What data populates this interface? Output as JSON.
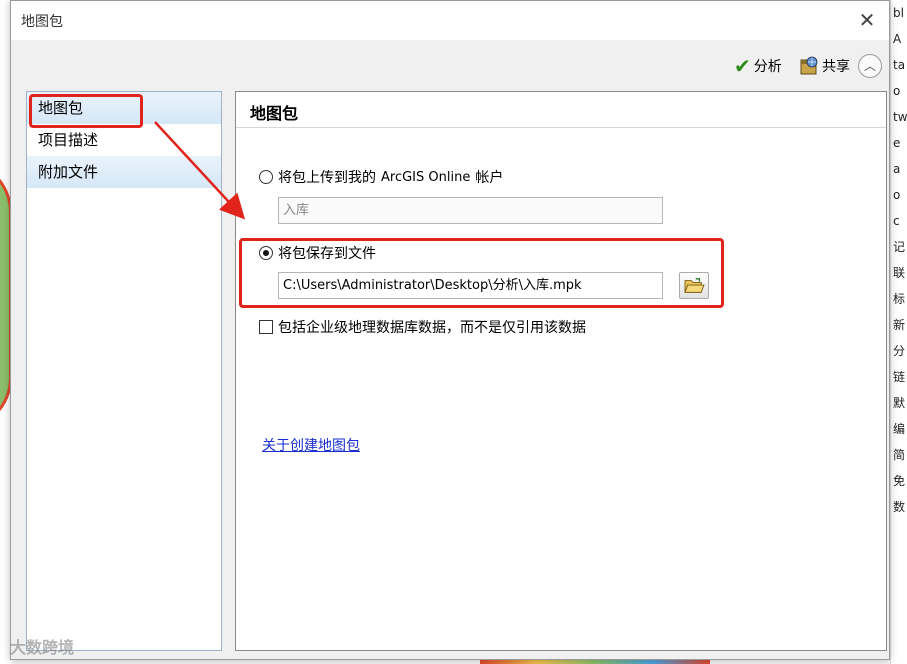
{
  "dialog": {
    "title": "地图包",
    "close_label": "✕"
  },
  "toolbar": {
    "analyze_label": "分析",
    "share_label": "共享",
    "collapse_label": "︿"
  },
  "nav": {
    "items": [
      {
        "label": "地图包"
      },
      {
        "label": "项目描述"
      },
      {
        "label": "附加文件"
      }
    ]
  },
  "main": {
    "heading": "地图包",
    "upload_option": {
      "label_prefix": "将包上传到我的",
      "label_arcgis": "ArcGIS Online",
      "label_suffix": "帐户",
      "selected": false
    },
    "upload_name_value": "入库",
    "save_option": {
      "label": "将包保存到文件",
      "selected": true
    },
    "save_path_value": "C:\\Users\\Administrator\\Desktop\\分析\\入库.mpk",
    "include_enterprise_label": "包括企业级地理数据库数据，而不是仅引用该数据",
    "include_enterprise_checked": false,
    "about_link": "关于创建地图包"
  },
  "background": {
    "right_strip_chars": [
      "bl",
      "A",
      "ta",
      "o",
      "tw",
      "e",
      "a",
      "o",
      "c",
      "记",
      "联",
      "标",
      "新",
      "分",
      "链",
      "默",
      "编",
      "简",
      "免",
      "数"
    ]
  },
  "watermark": "大数跨境",
  "colors": {
    "highlight_red": "#e0241c",
    "link_blue": "#1a2fd1",
    "analyze_check_green": "#2f8a1c"
  }
}
